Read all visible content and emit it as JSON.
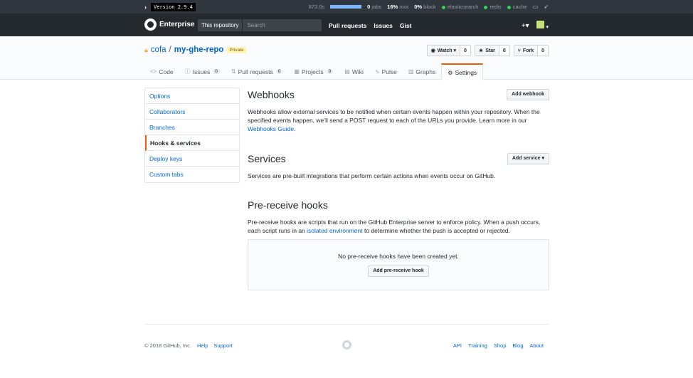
{
  "staffbar": {
    "version": "Version 2.9.4",
    "timing": "873.0s",
    "jobs_count": "0",
    "jobs_label": "jobs",
    "root_pct": "16%",
    "root_label": "root",
    "block_pct": "0%",
    "block_label": "block",
    "services": [
      "elasticsearch",
      "redis",
      "cache"
    ],
    "service_color": "#34d058"
  },
  "header": {
    "brand": "Enterprise",
    "scope_label": "This repository",
    "search_placeholder": "Search",
    "nav": [
      "Pull requests",
      "Issues",
      "Gist"
    ],
    "new_icon": "+▾",
    "avatar_caret": "▾"
  },
  "repo": {
    "owner": "cofa",
    "separator": "/",
    "name": "my-ghe-repo",
    "badge": "Private",
    "actions": {
      "watch": {
        "label": "Watch ▾",
        "count": "0"
      },
      "star": {
        "label": "Star",
        "count": "0"
      },
      "fork": {
        "label": "Fork",
        "count": "0"
      }
    },
    "tabs": [
      {
        "icon": "<>",
        "label": "Code",
        "count": ""
      },
      {
        "icon": "ⓘ",
        "label": "Issues",
        "count": "0"
      },
      {
        "icon": "⇅",
        "label": "Pull requests",
        "count": "0"
      },
      {
        "icon": "▦",
        "label": "Projects",
        "count": "0"
      },
      {
        "icon": "▤",
        "label": "Wiki",
        "count": ""
      },
      {
        "icon": "∿",
        "label": "Pulse",
        "count": ""
      },
      {
        "icon": "▥",
        "label": "Graphs",
        "count": ""
      },
      {
        "icon": "⚙",
        "label": "Settings",
        "count": ""
      }
    ]
  },
  "menu": {
    "items": [
      "Options",
      "Collaborators",
      "Branches",
      "Hooks & services",
      "Deploy keys",
      "Custom tabs"
    ],
    "selected": "Hooks & services"
  },
  "webhooks": {
    "title": "Webhooks",
    "button": "Add webhook",
    "text_before": "Webhooks allow external services to be notified when certain events happen within your repository. When the specified events happen, we’ll send a POST request to each of the URLs you provide. Learn more in our ",
    "link": "Webhooks Guide",
    "text_after": "."
  },
  "services": {
    "title": "Services",
    "button": "Add service ▾",
    "text": "Services are pre-built integrations that perform certain actions when events occur on GitHub."
  },
  "prereceive": {
    "title": "Pre-receive hooks",
    "text_before": "Pre-receive hooks are scripts that run on the GitHub Enterprise server to enforce policy. When a push occurs, each script runs in an ",
    "link": "isolated environment",
    "text_after": " to determine whether the push is accepted or rejected.",
    "empty_message": "No pre-receive hooks have been created yet.",
    "button": "Add pre-receive hook"
  },
  "footer": {
    "copyright": "© 2018 GitHub, Inc.",
    "left_links": [
      "Help",
      "Support"
    ],
    "right_links": [
      "API",
      "Training",
      "Shop",
      "Blog",
      "About"
    ]
  },
  "colors": {
    "accent": "#e36209",
    "link": "#0366d6",
    "header_bg": "#24292e"
  }
}
